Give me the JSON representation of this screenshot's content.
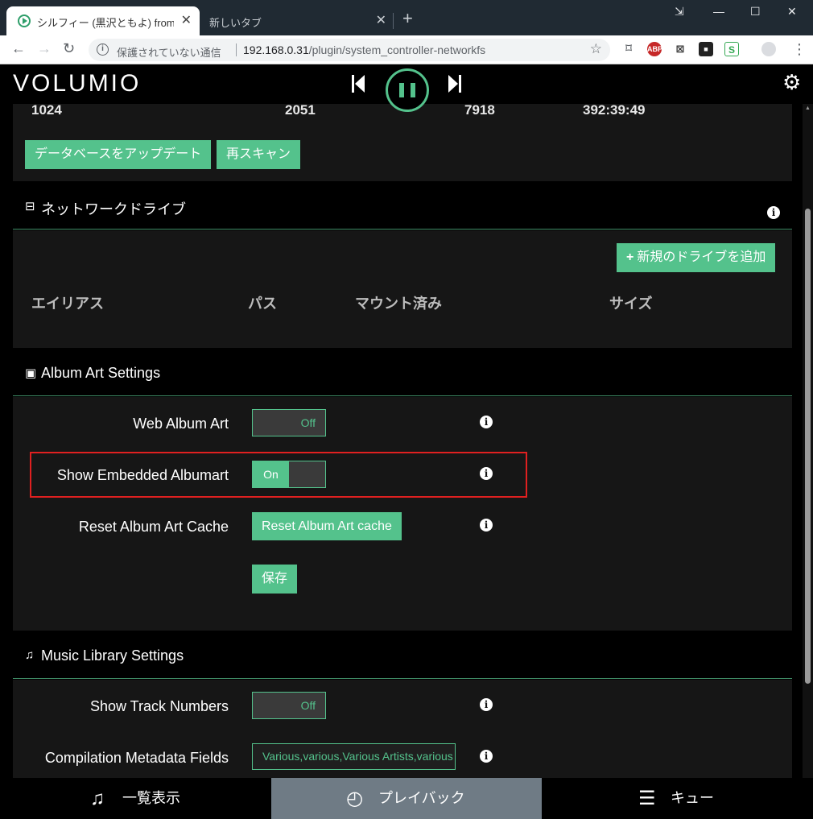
{
  "browser": {
    "active_tab_title": "シルフィー (黒沢ともよ) from i",
    "inactive_tab_title": "新しいタブ",
    "new_tab_glyph": "+",
    "close_glyph": "✕",
    "security_text": "保護されていない通信",
    "url_host": "192.168.0.31",
    "url_path": "/plugin/system_controller-networkfs",
    "nav": {
      "back": "←",
      "forward": "→",
      "reload": "↻"
    },
    "window_controls": {
      "minimize": "—",
      "maximize": "☐",
      "close": "✕",
      "cast": "⇲"
    },
    "star": "☆",
    "menu": "⋮"
  },
  "app": {
    "logo": "VOLUMIO",
    "stats": {
      "artists": "1024",
      "albums": "2051",
      "songs": "7918",
      "playtime": "392:39:49"
    },
    "update_db_button": "データベースをアップデート",
    "rescan_button": "再スキャン",
    "network_drives": {
      "title": "ネットワークドライブ",
      "add_button": "新規のドライブを追加",
      "add_icon": "+",
      "columns": [
        "エイリアス",
        "パス",
        "マウント済み",
        "サイズ"
      ]
    },
    "album_art": {
      "title": "Album Art Settings",
      "rows": [
        {
          "label": "Web Album Art",
          "value": "Off"
        },
        {
          "label": "Show Embedded Albumart",
          "value": "On"
        },
        {
          "label": "Reset Album Art Cache",
          "button": "Reset Album Art cache"
        }
      ],
      "save_button": "保存"
    },
    "music_library": {
      "title": "Music Library Settings",
      "rows": [
        {
          "label": "Show Track Numbers",
          "value": "Off"
        },
        {
          "label": "Compilation Metadata Fields",
          "value": "Various,various,Various Artists,various"
        }
      ]
    },
    "info_glyph": "i",
    "footer": {
      "browse": "一覧表示",
      "playback": "プレイバック",
      "queue": "キュー"
    }
  },
  "colors": {
    "accent": "#54c28c",
    "panel": "#161616",
    "highlight": "#e02020",
    "footer_active": "#6f7b85"
  }
}
